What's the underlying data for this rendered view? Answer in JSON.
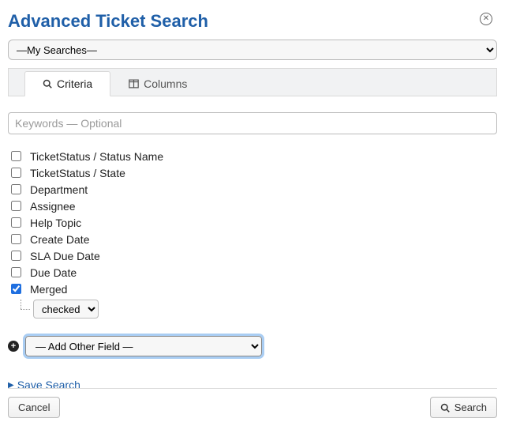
{
  "header": {
    "title": "Advanced Ticket Search"
  },
  "searches_dropdown": {
    "selected": "—My Searches—"
  },
  "tabs": {
    "criteria": "Criteria",
    "columns": "Columns"
  },
  "keywords": {
    "placeholder": "Keywords — Optional",
    "value": ""
  },
  "fields": [
    {
      "label": "TicketStatus / Status Name",
      "checked": false
    },
    {
      "label": "TicketStatus / State",
      "checked": false
    },
    {
      "label": "Department",
      "checked": false
    },
    {
      "label": "Assignee",
      "checked": false
    },
    {
      "label": "Help Topic",
      "checked": false
    },
    {
      "label": "Create Date",
      "checked": false
    },
    {
      "label": "SLA Due Date",
      "checked": false
    },
    {
      "label": "Due Date",
      "checked": false
    },
    {
      "label": "Merged",
      "checked": true
    }
  ],
  "merged_sub": {
    "selected": "checked"
  },
  "add_other_field": {
    "selected": "— Add Other Field —"
  },
  "save_search_label": "Save Search",
  "buttons": {
    "cancel": "Cancel",
    "search": "Search"
  }
}
